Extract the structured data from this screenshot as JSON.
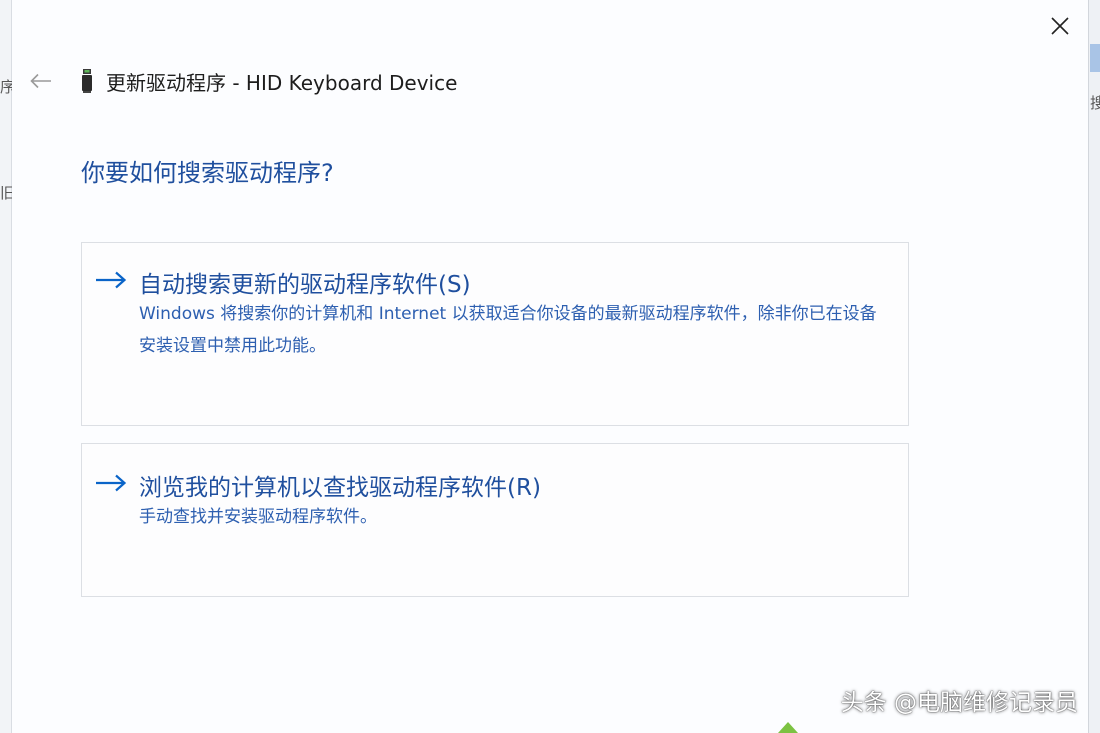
{
  "dialog": {
    "title": "更新驱动程序 - HID Keyboard Device",
    "question": "你要如何搜索驱动程序?",
    "options": [
      {
        "title": "自动搜索更新的驱动程序软件(S)",
        "description": "Windows 将搜索你的计算机和 Internet 以获取适合你设备的最新驱动程序软件，除非你已在设备安装设置中禁用此功能。"
      },
      {
        "title": "浏览我的计算机以查找驱动程序软件(R)",
        "description": "手动查找并安装驱动程序软件。"
      }
    ]
  },
  "background": {
    "left_fragments": [
      "序",
      "旧"
    ],
    "right_fragments": [
      "搜"
    ]
  },
  "watermark": "头条 @电脑维修记录员",
  "icons": {
    "back": "back-arrow-icon",
    "device": "keyboard-device-icon",
    "close": "close-icon",
    "option_arrow": "right-arrow-icon"
  },
  "colors": {
    "accent": "#1f4f9e",
    "link": "#2d5fb0",
    "arrow": "#0a64c8",
    "border": "#dcdfe4"
  }
}
